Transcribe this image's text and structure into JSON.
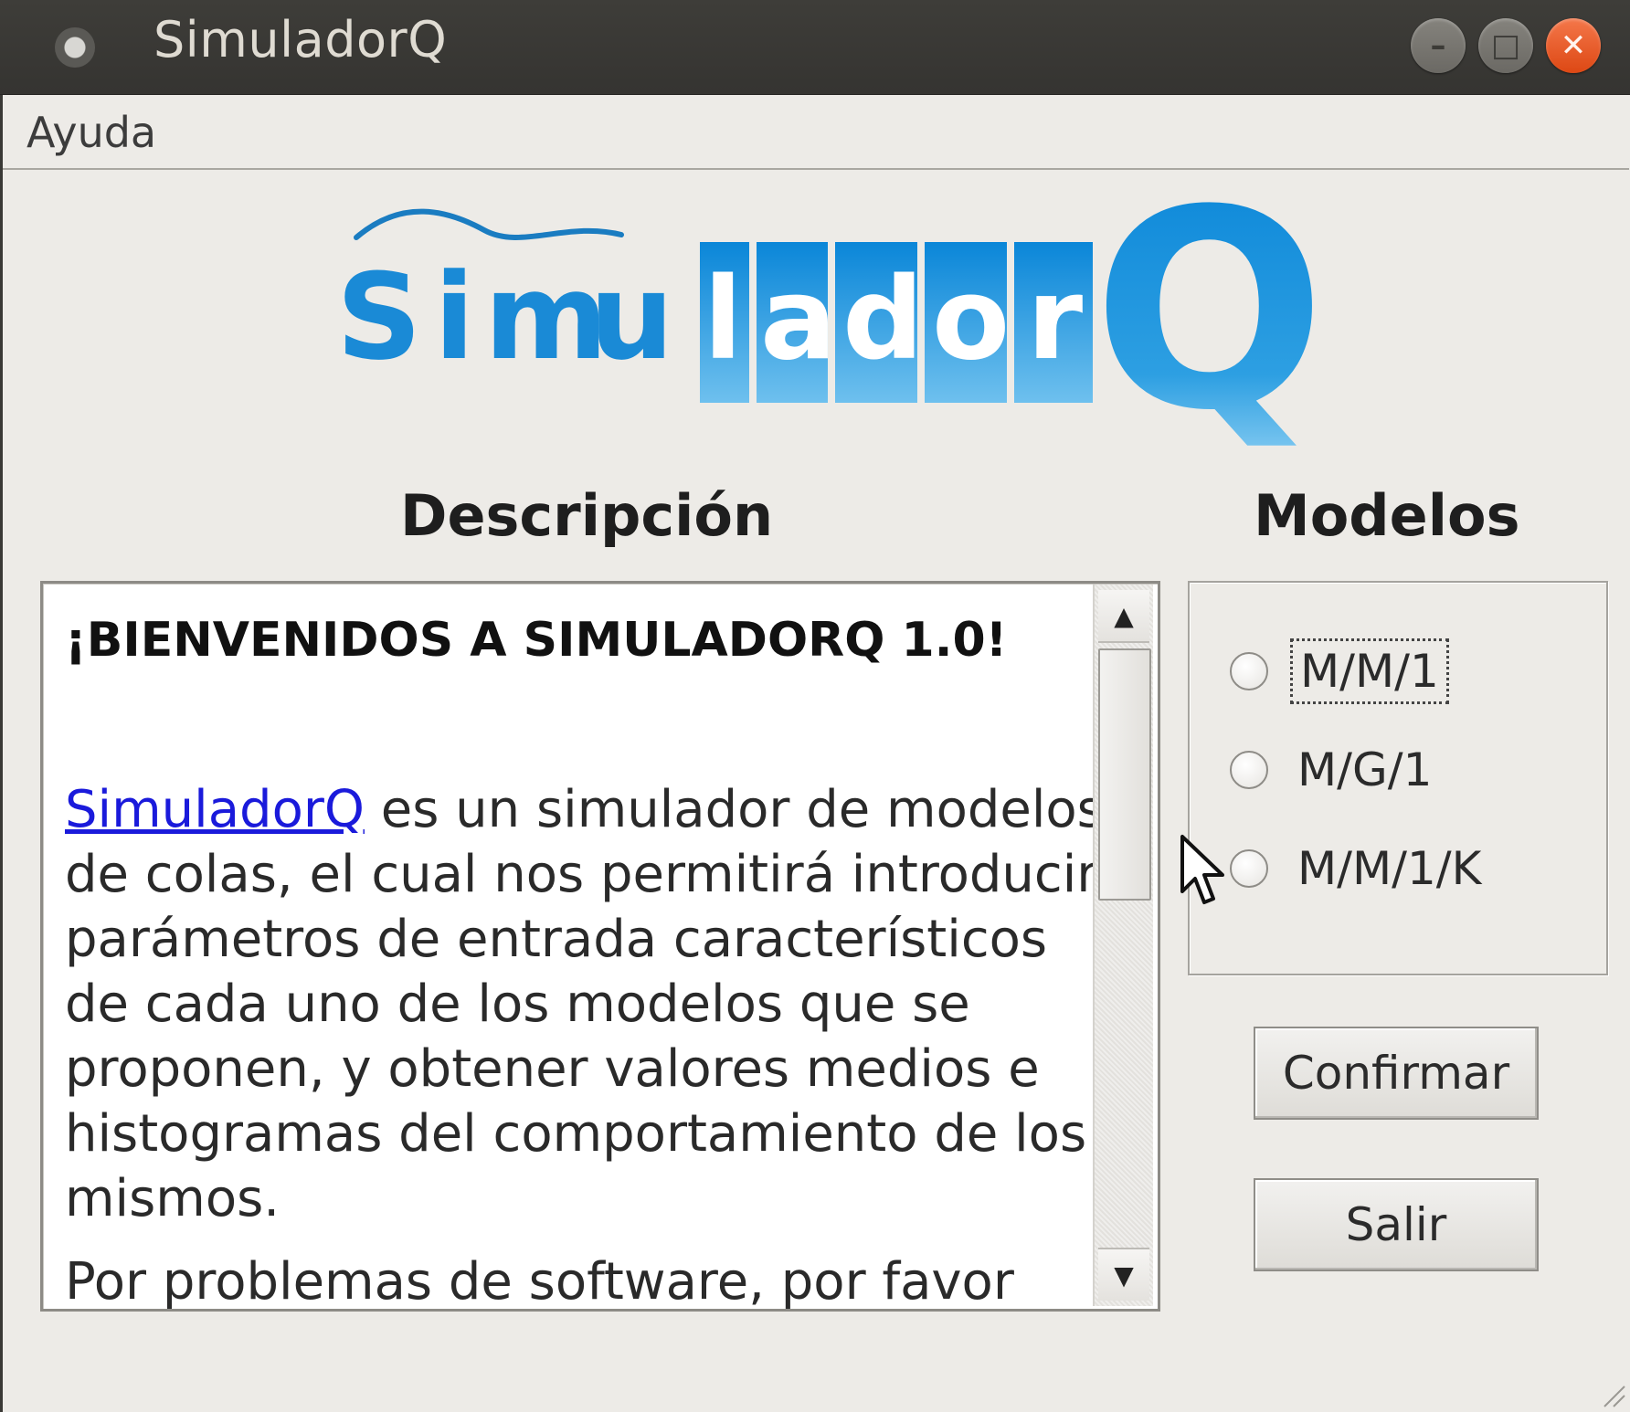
{
  "window": {
    "title": "SimuladorQ",
    "controls": {
      "minimize": "–",
      "maximize": "□",
      "close": "✕"
    }
  },
  "menubar": {
    "items": [
      {
        "label": "Ayuda"
      }
    ]
  },
  "logo": {
    "text_parts": [
      "S",
      "i",
      "m",
      "u",
      "l",
      "a",
      "d",
      "o",
      "r",
      "Q"
    ],
    "brand_color": "#1f8fd6"
  },
  "description": {
    "heading": "Descripción",
    "title": "¡BIENVENIDOS A SIMULADORQ 1.0!",
    "link_text": "SimuladorQ",
    "paragraph_rest": " es un simulador de modelos de colas, el cual nos permitirá introducir parámetros de entrada característicos de cada uno de los modelos que se proponen, y obtener valores medios e histogramas del comportamiento de los mismos.",
    "cut_off_line": "Por problemas de software, por favor"
  },
  "models": {
    "heading": "Modelos",
    "options": [
      {
        "label": "M/M/1",
        "selected": false,
        "focused": true
      },
      {
        "label": "M/G/1",
        "selected": false,
        "focused": false
      },
      {
        "label": "M/M/1/K",
        "selected": false,
        "focused": false
      }
    ]
  },
  "buttons": {
    "confirm": "Confirmar",
    "exit": "Salir"
  },
  "colors": {
    "titlebar": "#3c3b37",
    "close_button": "#e95420",
    "link": "#1a1adb",
    "window_bg": "#edebe7"
  }
}
